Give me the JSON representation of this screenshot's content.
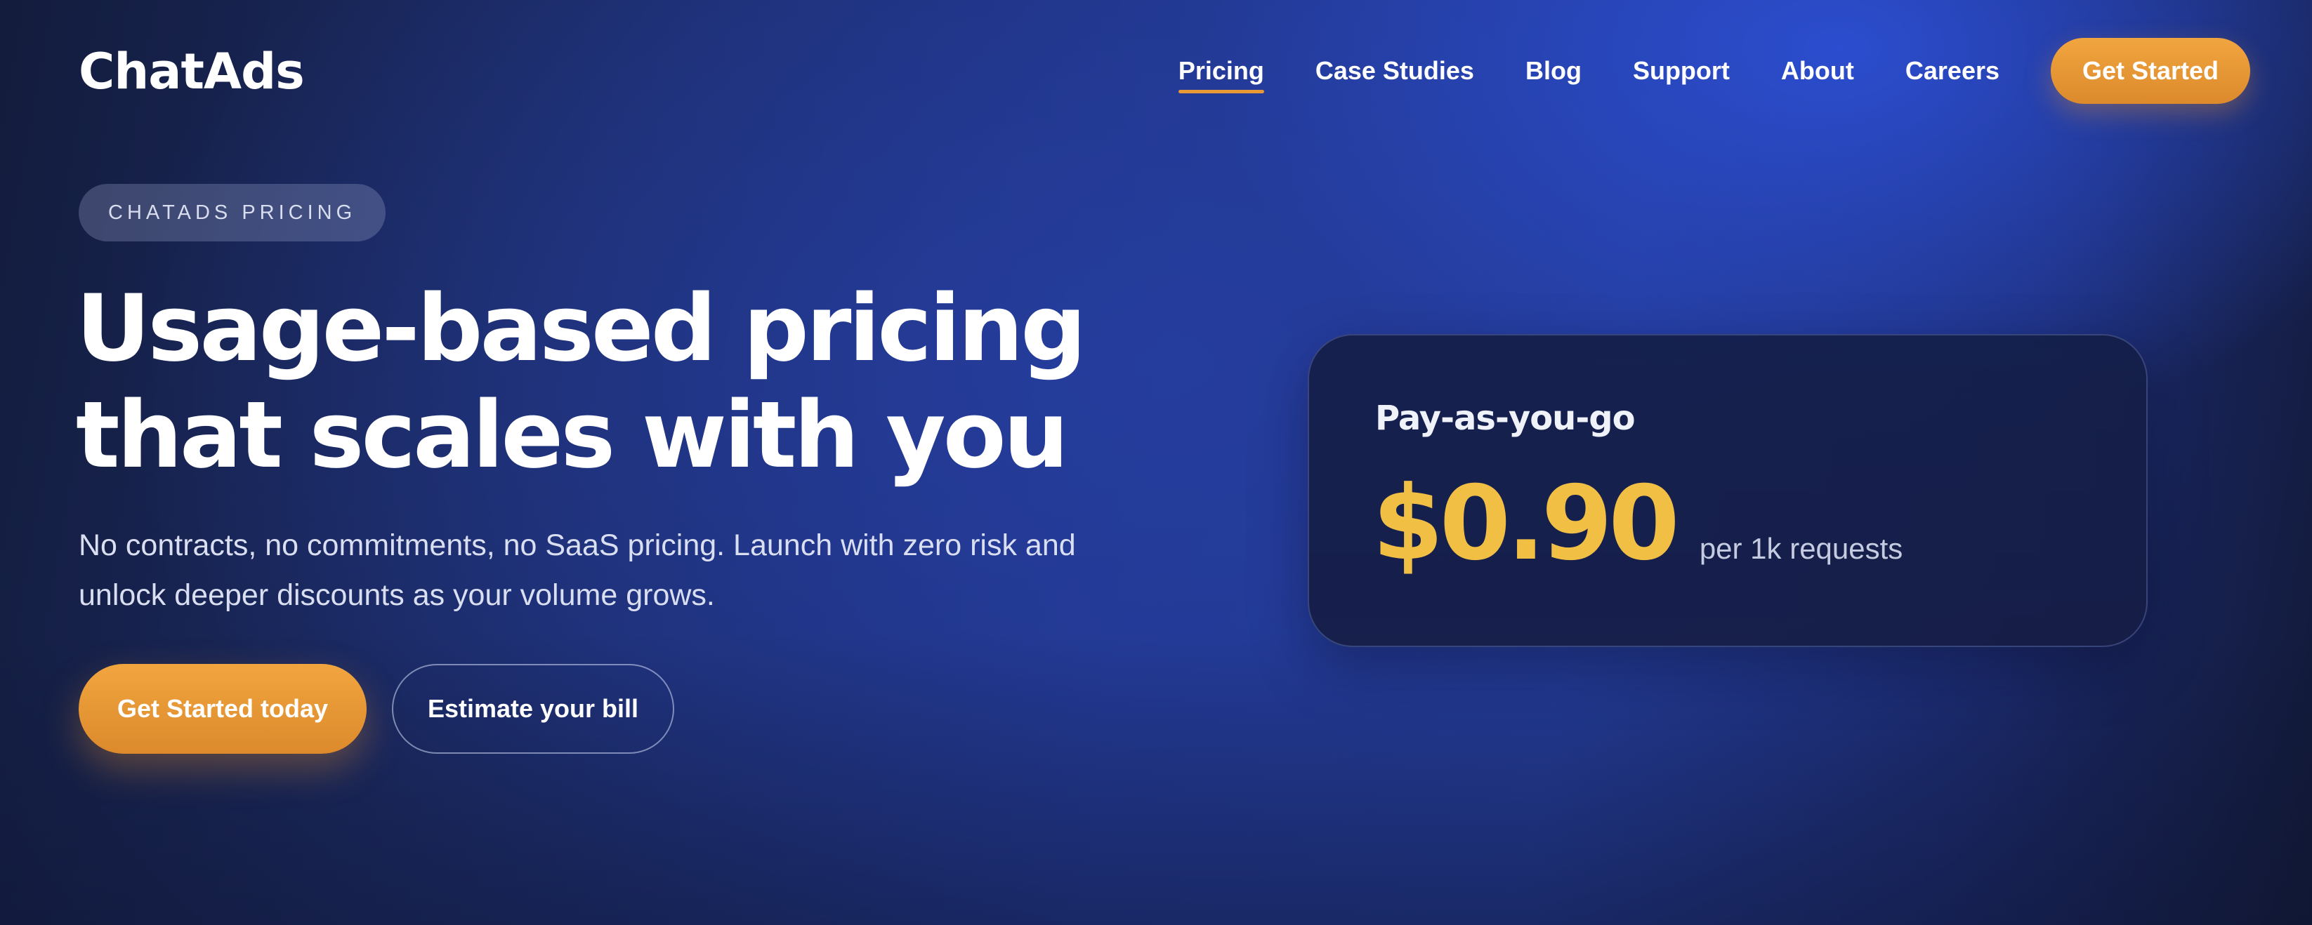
{
  "brand": {
    "name": "ChatAds"
  },
  "nav": {
    "links": [
      {
        "label": "Pricing",
        "active": true
      },
      {
        "label": "Case Studies",
        "active": false
      },
      {
        "label": "Blog",
        "active": false
      },
      {
        "label": "Support",
        "active": false
      },
      {
        "label": "About",
        "active": false
      },
      {
        "label": "Careers",
        "active": false
      }
    ],
    "cta_label": "Get Started"
  },
  "hero": {
    "badge": "CHATADS PRICING",
    "headline_lines": [
      "Usage-based pricing",
      "that scales with you"
    ],
    "subtext_lines": [
      "No contracts, no commitments, no SaaS pricing. Launch with zero risk and",
      "unlock deeper discounts as your volume grows."
    ],
    "primary_cta": "Get Started today",
    "secondary_cta": "Estimate your bill"
  },
  "pricing_card": {
    "title": "Pay-as-you-go",
    "price": "$0.90",
    "unit": "per 1k requests"
  },
  "colors": {
    "accent_orange": "#e99a36",
    "price_yellow": "#f2bf45",
    "background_navy": "#1b2a63"
  }
}
